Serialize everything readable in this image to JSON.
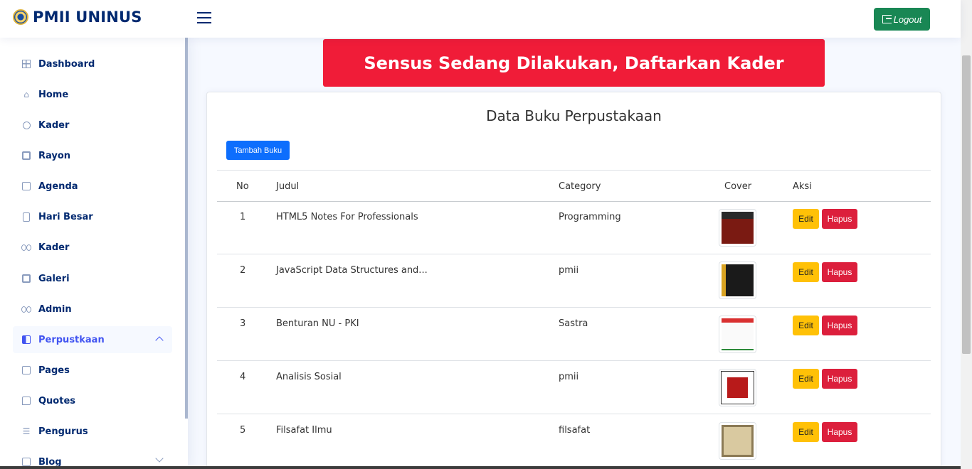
{
  "app": {
    "title": "PMII UNINUS",
    "logout_label": "Logout"
  },
  "sidebar": {
    "items": [
      {
        "label": "Dashboard",
        "icon": "grid-icon"
      },
      {
        "label": "Home",
        "icon": "house-icon"
      },
      {
        "label": "Kader",
        "icon": "person-icon"
      },
      {
        "label": "Rayon",
        "icon": "copy-icon"
      },
      {
        "label": "Agenda",
        "icon": "calendar-icon"
      },
      {
        "label": "Hari Besar",
        "icon": "bookmark-icon"
      },
      {
        "label": "Kader",
        "icon": "people-icon"
      },
      {
        "label": "Galeri",
        "icon": "image-icon"
      },
      {
        "label": "Admin",
        "icon": "people-icon"
      },
      {
        "label": "Perpustkaan",
        "icon": "book-icon",
        "active": true
      },
      {
        "label": "Pages",
        "icon": "card-list-icon"
      },
      {
        "label": "Quotes",
        "icon": "chat-icon"
      },
      {
        "label": "Pengurus",
        "icon": "person-lines-icon"
      },
      {
        "label": "Blog",
        "icon": "journal-icon"
      }
    ]
  },
  "banner": {
    "text": "Sensus Sedang Dilakukan, Daftarkan Kader"
  },
  "card": {
    "title": "Data Buku Perpustakaan",
    "add_button": "Tambah Buku",
    "columns": {
      "no": "No",
      "judul": "Judul",
      "category": "Category",
      "cover": "Cover",
      "aksi": "Aksi"
    },
    "edit_label": "Edit",
    "delete_label": "Hapus",
    "rows": [
      {
        "no": "1",
        "judul": "HTML5 Notes For Professionals",
        "category": "Programming"
      },
      {
        "no": "2",
        "judul": "JavaScript Data Structures and...",
        "category": "pmii"
      },
      {
        "no": "3",
        "judul": "Benturan NU - PKI",
        "category": "Sastra"
      },
      {
        "no": "4",
        "judul": "Analisis Sosial",
        "category": "pmii"
      },
      {
        "no": "5",
        "judul": "Filsafat Ilmu",
        "category": "filsafat"
      }
    ]
  },
  "colors": {
    "primary": "#0d6efd",
    "danger": "#dc1f3c",
    "warning": "#ffc107",
    "success": "#198754",
    "banner": "#f01c38",
    "nav": "#012970"
  }
}
